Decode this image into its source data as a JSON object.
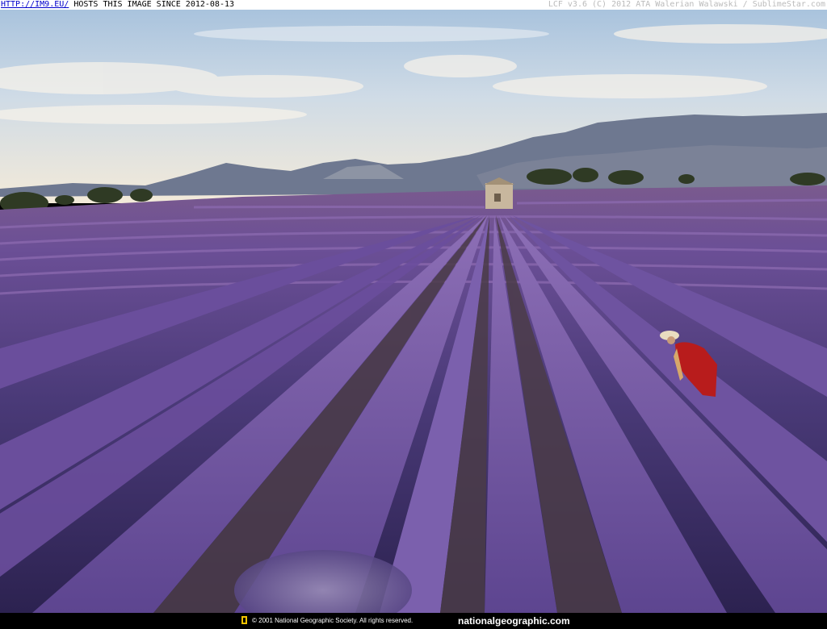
{
  "header": {
    "link_text": "HTTP://IM9.EU/",
    "hosted_text": "HOSTS THIS IMAGE SINCE 2012-08-13",
    "credit_text": "LCF v3.6 (C) 2012 ATA Walerian Walawski / SublimeStar.com"
  },
  "footer": {
    "copyright_text": "© 2001 National Geographic Society. All rights reserved.",
    "site_text": "nationalgeographic.com",
    "logo_color": "#f6c400"
  },
  "colors": {
    "lavender_dark": "#3a2a66",
    "lavender_mid": "#6a4f9a",
    "lavender_light": "#9d7fc3",
    "soil": "#5b4a48",
    "sky_top": "#b9d0e6",
    "sky_bottom": "#f2eadb",
    "mountains": "#6f7a92",
    "background": "#000000"
  }
}
